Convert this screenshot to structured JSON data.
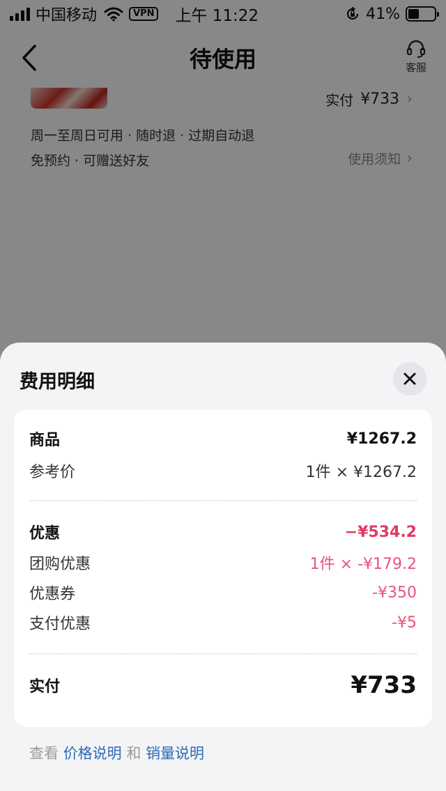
{
  "status_bar": {
    "carrier": "中国移动",
    "vpn": "VPN",
    "time": "上午 11:22",
    "battery": "41%",
    "battery_level": 0.41
  },
  "nav": {
    "title": "待使用",
    "service_label": "客服"
  },
  "order": {
    "paid_label": "实付",
    "paid_value": "¥733",
    "features_line1": "周一至周日可用 · 随时退 · 过期自动退",
    "features_line2": "免预约 · 可赠送好友",
    "notice_label": "使用须知"
  },
  "sheet": {
    "title": "费用明细",
    "goods": {
      "label": "商品",
      "value": "¥1267.2",
      "ref_label": "参考价",
      "ref_value": "1件 × ¥1267.2"
    },
    "discount": {
      "label": "优惠",
      "value": "−¥534.2",
      "items": [
        {
          "label": "团购优惠",
          "value": "1件 × -¥179.2"
        },
        {
          "label": "优惠券",
          "value": "-¥350"
        },
        {
          "label": "支付优惠",
          "value": "-¥5"
        }
      ]
    },
    "total": {
      "label": "实付",
      "value": "¥733"
    },
    "footer": {
      "prefix": "查看",
      "price_link": "价格说明",
      "conj": "和",
      "sales_link": "销量说明"
    }
  },
  "colors": {
    "discount_pink": "#e8537a",
    "link_blue": "#2a6bb5"
  }
}
